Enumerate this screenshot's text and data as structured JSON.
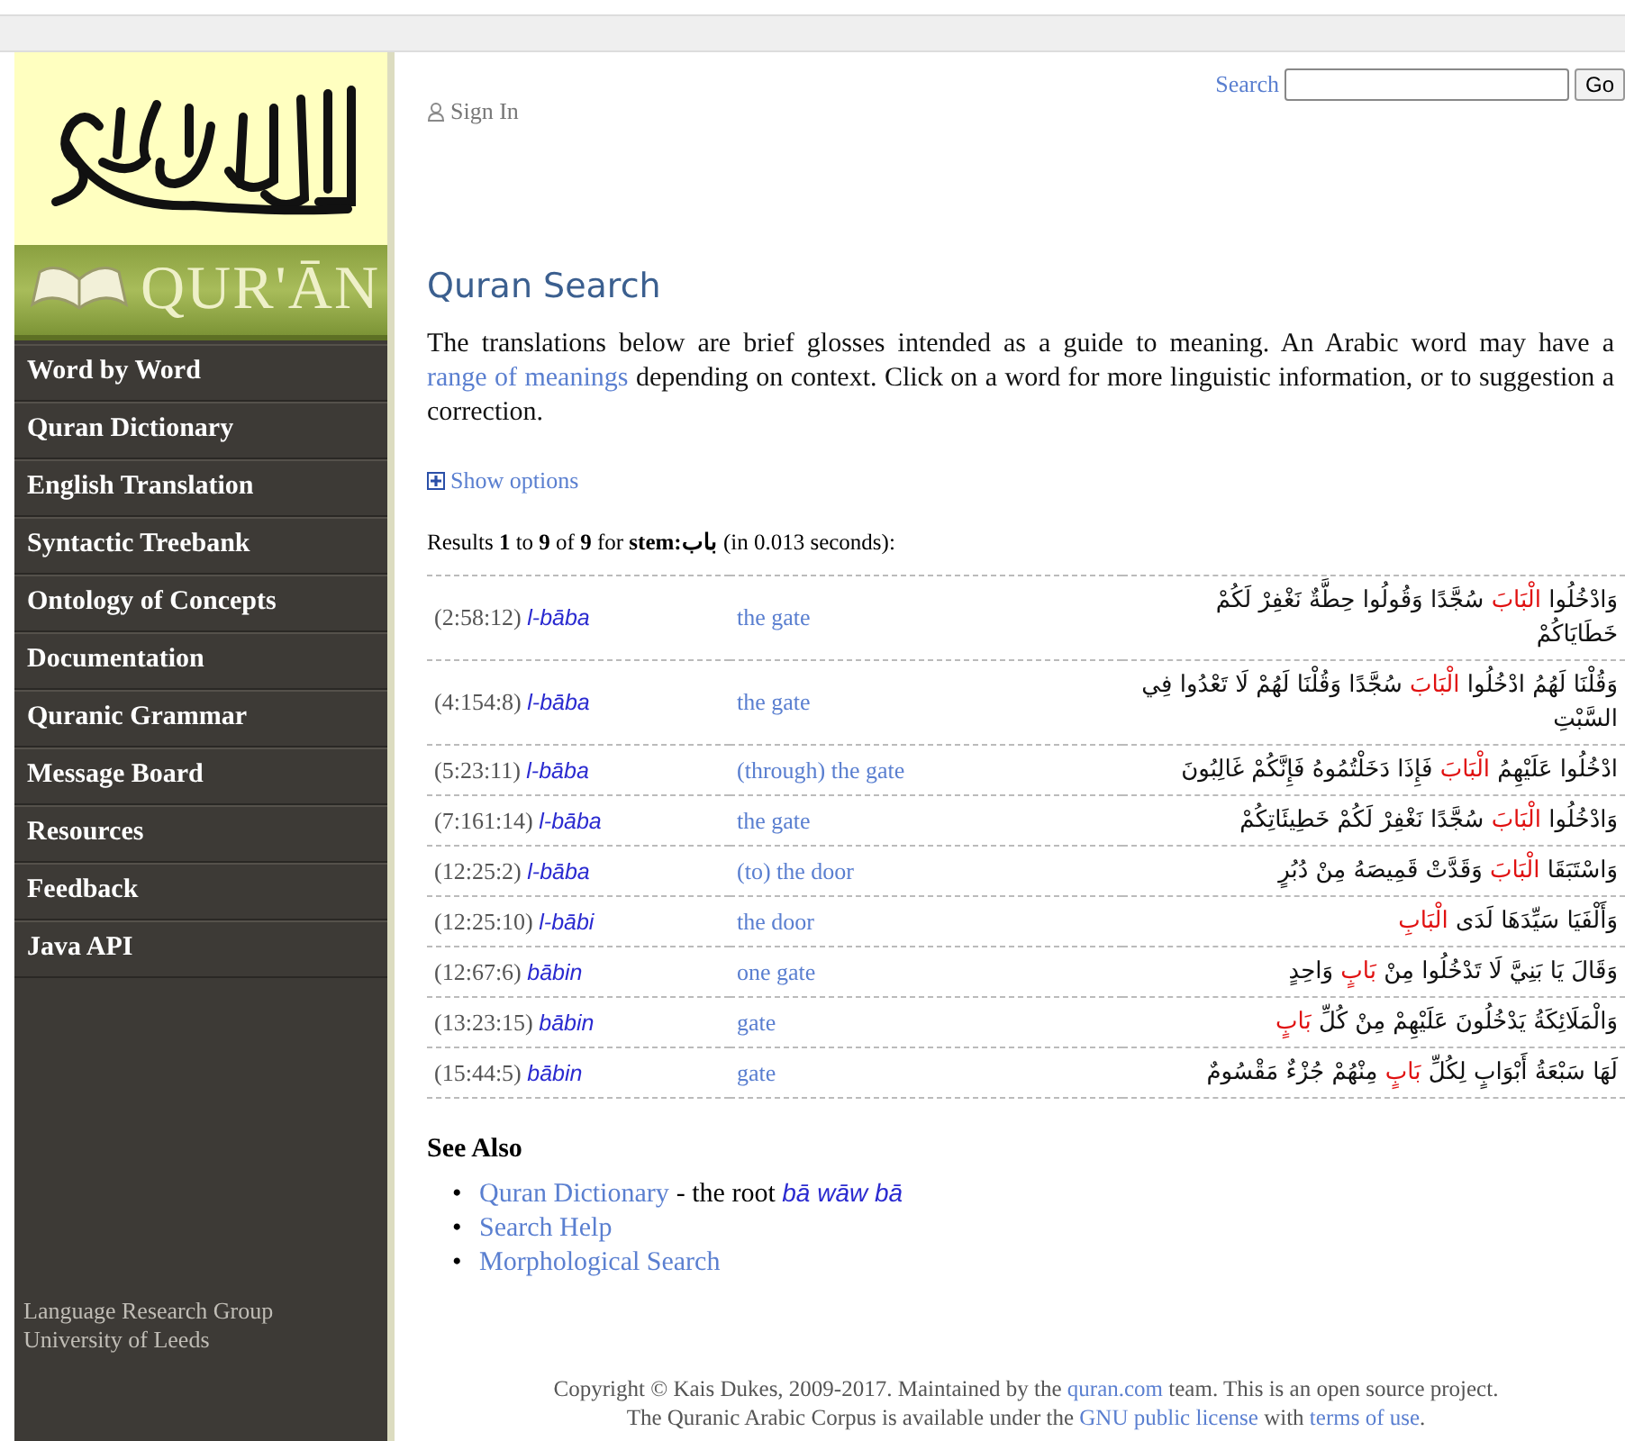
{
  "sidebar": {
    "banner_title": "QUR'ĀN",
    "items": [
      {
        "label": "Word by Word"
      },
      {
        "label": "Quran Dictionary"
      },
      {
        "label": "English Translation"
      },
      {
        "label": "Syntactic Treebank"
      },
      {
        "label": "Ontology of Concepts"
      },
      {
        "label": "Documentation"
      },
      {
        "label": "Quranic Grammar"
      },
      {
        "label": "Message Board"
      },
      {
        "label": "Resources"
      },
      {
        "label": "Feedback"
      },
      {
        "label": "Java API"
      }
    ],
    "footer": [
      "Language Research Group",
      "University of Leeds"
    ]
  },
  "header": {
    "sign_in": "Sign In",
    "search_label": "Search",
    "go_button": "Go"
  },
  "title": "Quran Search",
  "intro": {
    "before": "The translations below are brief glosses intended as a guide to meaning. An Arabic word may have a",
    "link": "range of meanings",
    "after": "depending on context. Click on a word for more linguistic information, or to suggestion a correction."
  },
  "show_options": "Show options",
  "results_summary": "Results **1** to **9** of **9** for **stem:باب** (in 0.013 seconds):",
  "results": [
    {
      "ref": "(2:58:12)",
      "translit": "l-bāba",
      "gloss": "the gate",
      "before": "وَادْخُلُوا",
      "stem": "الْبَابَ",
      "after": "سُجَّدًا وَقُولُوا حِطَّةٌ نَغْفِرْ لَكُمْ خَطَايَاكُمْ"
    },
    {
      "ref": "(4:154:8)",
      "translit": "l-bāba",
      "gloss": "the gate",
      "before": "وَقُلْنَا لَهُمُ ادْخُلُوا",
      "stem": "الْبَابَ",
      "after": "سُجَّدًا وَقُلْنَا لَهُمْ لَا تَعْدُوا فِي السَّبْتِ"
    },
    {
      "ref": "(5:23:11)",
      "translit": "l-bāba",
      "gloss": "(through) the gate",
      "before": "ادْخُلُوا عَلَيْهِمُ",
      "stem": "الْبَابَ",
      "after": "فَإِذَا دَخَلْتُمُوهُ فَإِنَّكُمْ غَالِبُونَ"
    },
    {
      "ref": "(7:161:14)",
      "translit": "l-bāba",
      "gloss": "the gate",
      "before": "وَادْخُلُوا",
      "stem": "الْبَابَ",
      "after": "سُجَّدًا نَغْفِرْ لَكُمْ خَطِيئَاتِكُمْ"
    },
    {
      "ref": "(12:25:2)",
      "translit": "l-bāba",
      "gloss": "(to) the door",
      "before": "وَاسْتَبَقَا",
      "stem": "الْبَابَ",
      "after": "وَقَدَّتْ قَمِيصَهُ مِنْ دُبُرٍ"
    },
    {
      "ref": "(12:25:10)",
      "translit": "l-bābi",
      "gloss": "the door",
      "before": "وَأَلْفَيَا سَيِّدَهَا لَدَى",
      "stem": "الْبَابِ"
    },
    {
      "ref": "(12:67:6)",
      "translit": "bābin",
      "gloss": "one gate",
      "before": "وَقَالَ يَا بَنِيَّ لَا تَدْخُلُوا مِنْ",
      "stem": "بَابٍ",
      "after": "وَاحِدٍ"
    },
    {
      "ref": "(13:23:15)",
      "translit": "bābin",
      "gloss": "gate",
      "before": "وَالْمَلَائِكَةُ يَدْخُلُونَ عَلَيْهِمْ مِنْ كُلِّ",
      "stem": "بَابٍ"
    },
    {
      "ref": "(15:44:5)",
      "translit": "bābin",
      "gloss": "gate",
      "before": "لَهَا سَبْعَةُ أَبْوَابٍ لِكُلِّ",
      "stem": "بَابٍ",
      "after": "مِنْهُمْ جُزْءٌ مَقْسُومٌ"
    }
  ],
  "see_also": {
    "heading": "See Also",
    "items": [
      {
        "bullet": "•",
        "link": "Quran Dictionary",
        "text": "- the root",
        "translit": "bā wāw bā"
      },
      {
        "bullet": "•",
        "link": "Search Help"
      },
      {
        "bullet": "•",
        "link": "Morphological Search"
      }
    ]
  },
  "copyright": {
    "line1_before": "Copyright © Kais Dukes, 2009-2017. Maintained by the",
    "line1_link": "quran.com",
    "line1_after": "team. This is an open source project.",
    "line2_before": "The Quranic Arabic Corpus is available under the",
    "line2_link1": "GNU public license",
    "line2_mid": "with",
    "line2_link2": "terms of use",
    "line2_end": "."
  }
}
